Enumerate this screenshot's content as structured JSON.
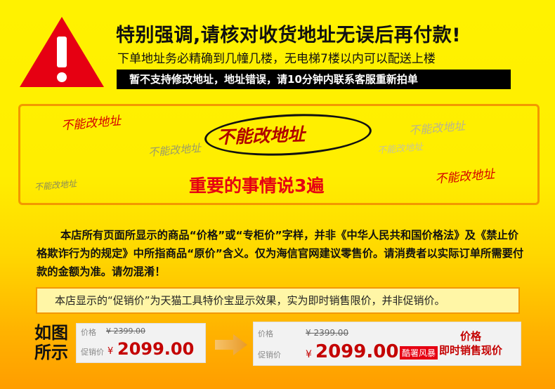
{
  "header": {
    "headline": "特别强调,请核对收货地址无误后再付款!",
    "subline": "下单地址务必精确到几幢几楼，无电梯7楼以内可以配送上楼",
    "bar_text": "暂不支持修改地址，地址错误，请10分钟内联系客服重新拍单"
  },
  "warning_mark": "!",
  "stamps": {
    "red1": "不能改地址",
    "gray1": "不能改地址",
    "gray2": "不能改地址",
    "gray3": "不能改地址",
    "gray4": "不能改地址",
    "red2": "不能改地址",
    "main": "不能改地址"
  },
  "important": "重要的事情说3遍",
  "notice": "本店所有页面所显示的商品“价格”或“专柜价”字样，并非《中华人民共和国价格法》及《禁止价格欺诈行为的规定》中所指商品“原价”含义。仅为海信官网建议零售价。请消费者以实际订单所需要付款的金额为准。请勿混淆！",
  "promo": "本店显示的“促销价”为天猫工具特价宝显示效果，实为即时销售限价，并非促销价。",
  "example_label": "如图所示",
  "example_label_line1": "如图",
  "example_label_line2": "所示",
  "price_before": {
    "price_label": "价格",
    "orig": "¥ 2399.00",
    "promo_label": "促销价",
    "yen": "¥",
    "now": "2099.00"
  },
  "price_after": {
    "price_label": "价格",
    "orig": "¥ 2399.00",
    "promo_label": "促销价",
    "yen": "¥",
    "now": "2099.00",
    "tag": "酷署风暴",
    "right_line1": "价格",
    "right_line2": "即时销售现价"
  },
  "colors": {
    "accent_red": "#e60012",
    "border_orange": "#f39800",
    "warning_red": "#e60012"
  }
}
